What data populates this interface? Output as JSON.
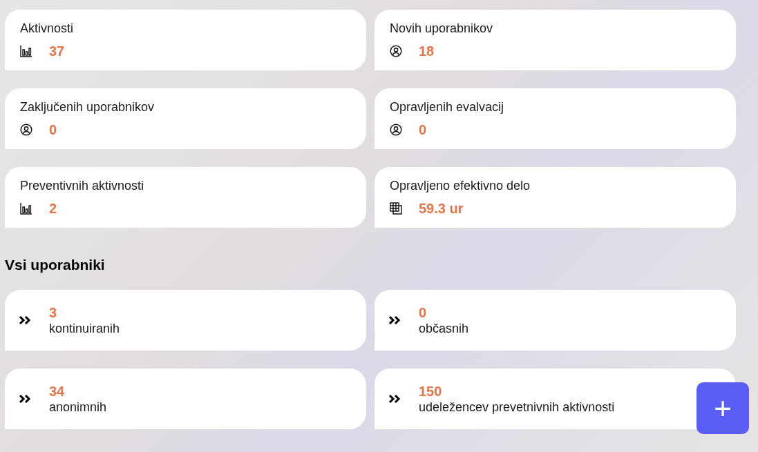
{
  "stats": [
    {
      "label": "Aktivnosti",
      "value": "37",
      "kind": "activity"
    },
    {
      "label": "Novih uporabnikov",
      "value": "18",
      "kind": "users"
    },
    {
      "label": "Zaključenih uporabnikov",
      "value": "0",
      "kind": "users"
    },
    {
      "label": "Opravljenih evalvacij",
      "value": "0",
      "kind": "users"
    },
    {
      "label": "Preventivnih aktivnosti",
      "value": "2",
      "kind": "activity"
    },
    {
      "label": "Opravljeno efektivno delo",
      "value": "59.3 ur",
      "kind": "work"
    }
  ],
  "users_section": {
    "title": "Vsi uporabniki",
    "items": [
      {
        "value": "3",
        "label": "kontinuiranih"
      },
      {
        "value": "0",
        "label": "občasnih"
      },
      {
        "value": "34",
        "label": "anonimnih"
      },
      {
        "value": "150",
        "label": "udeležencev prevetnivnih aktivnosti"
      }
    ]
  },
  "fab": {
    "symbol": "+"
  }
}
